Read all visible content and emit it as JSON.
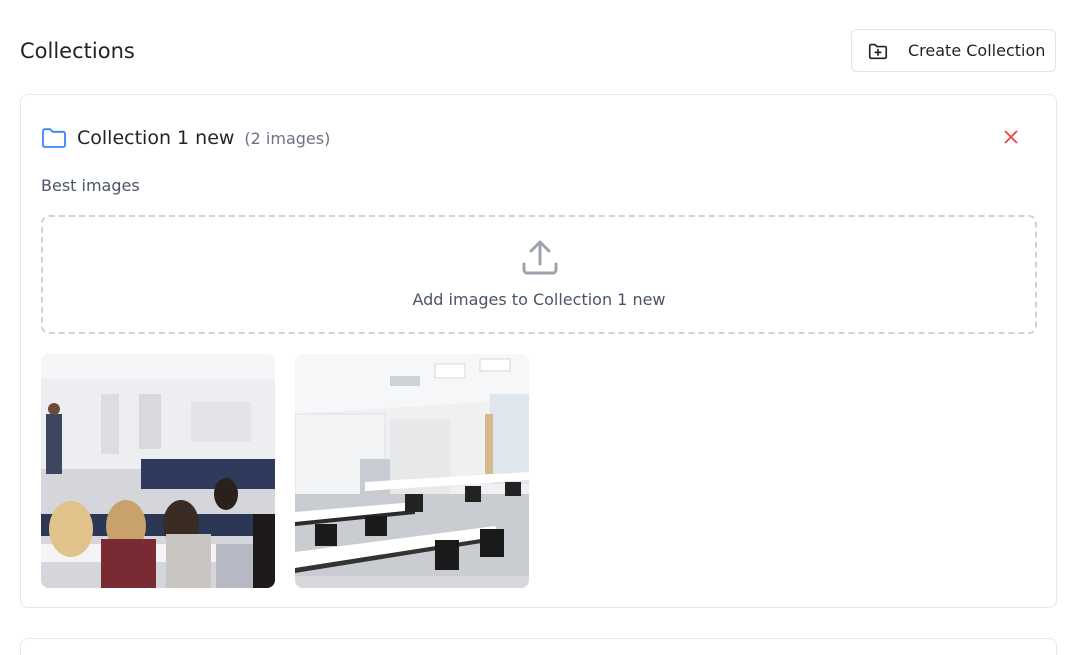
{
  "header": {
    "title": "Collections",
    "create_button_label": "Create Collection"
  },
  "collection": {
    "name": "Collection 1 new",
    "image_count": "(2 images)",
    "description": "Best images",
    "dropzone_text": "Add images to Collection 1 new",
    "images": [
      {
        "subject": "classroom-with-students"
      },
      {
        "subject": "empty-classroom"
      }
    ]
  },
  "colors": {
    "folder_icon": "#3b82f6",
    "close_icon": "#ef4444",
    "upload_icon": "#9ca3af"
  }
}
